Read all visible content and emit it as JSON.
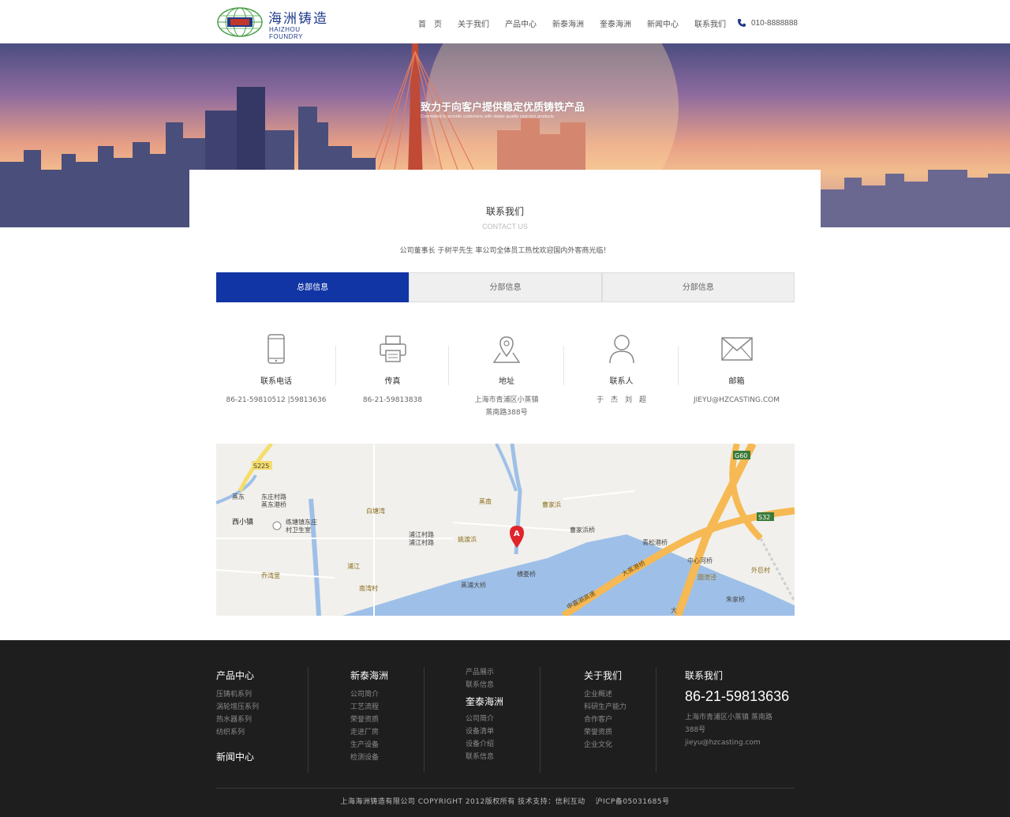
{
  "brand": {
    "name_cn": "海洲铸造",
    "name_en": "HAIZHOU FOUNDRY",
    "primary_color": "#1235a5"
  },
  "nav": {
    "items": [
      "首　页",
      "关于我们",
      "产品中心",
      "新泰海洲",
      "奎泰海洲",
      "新闻中心",
      "联系我们"
    ],
    "phone": "010-8888888",
    "phone_icon": "phone-icon"
  },
  "banner": {
    "title": "致力于向客户提供稳定优质铸铁产品",
    "subtitle": "Committed to provide customers with stable quality cast iron products"
  },
  "section": {
    "title": "联系我们",
    "subtitle": "CONTACT US",
    "description": "公司董事长 于树平先生 率公司全体员工热忱欢迎国内外客商光临！"
  },
  "tabs": [
    {
      "label": "总部信息",
      "active": true
    },
    {
      "label": "分部信息",
      "active": false
    },
    {
      "label": "分部信息",
      "active": false
    }
  ],
  "contacts": [
    {
      "icon": "mobile-phone-icon",
      "label": "联系电话",
      "value": "86-21-59810512 |59813636"
    },
    {
      "icon": "fax-printer-icon",
      "label": "传真",
      "value": "86-21-59813838"
    },
    {
      "icon": "map-pin-icon",
      "label": "地址",
      "value": "上海市青浦区小蒸镇",
      "value2": "蒸南路388号"
    },
    {
      "icon": "person-icon",
      "label": "联系人",
      "value": "于　杰　刘　超"
    },
    {
      "icon": "envelope-icon",
      "label": "邮箱",
      "value": "JIEYU@HZCASTING.COM"
    }
  ],
  "map": {
    "labels": {
      "s225": "S225",
      "g60": "G60",
      "s32": "S32",
      "zhengdong": "蒸东",
      "dongzhuang": "东庄村路",
      "zhengdongqiao": "蒸东港桥",
      "xixiao": "西小镇",
      "liantang": "练塘镇东庄",
      "weisheng": "村卫生室",
      "baitang": "白塘湾",
      "zhengnan": "蒸南",
      "caojiabang": "曹家浜",
      "caojiabangqiao": "曹家浜桥",
      "pujiang1": "浦江村路",
      "pujiang2": "浦江村路",
      "yaodu": "姚渡浜",
      "qingsong": "青松港桥",
      "pujiangcun": "浦江",
      "qiaowan": "乔湾里",
      "nanwan": "南湾村",
      "zhengpu": "蒸浦大桥",
      "henglou": "横娄桥",
      "shenjiahu": "申嘉湖高速",
      "dazheng": "大蒸港桥",
      "zhongxin": "中心河桥",
      "waiju": "外巨村",
      "yuanlu": "圆泄泾",
      "zhujia": "朱家桥",
      "da": "大",
      "marker": "A"
    }
  },
  "footer": {
    "col1": {
      "title": "产品中心",
      "items": [
        "压铸机系列",
        "涡轮增压系列",
        "热水器系列",
        "纺织系列"
      ],
      "title2": "新闻中心"
    },
    "col2": {
      "title": "新泰海洲",
      "items": [
        "公司简介",
        "工艺流程",
        "荣誉资质",
        "走进厂房",
        "生产设备",
        "检测设备"
      ]
    },
    "col3": {
      "pre": [
        "产品展示",
        "联系信息"
      ],
      "title": "奎泰海洲",
      "items": [
        "公司简介",
        "设备清单",
        "设备介绍",
        "联系信息"
      ]
    },
    "col4": {
      "title": "关于我们",
      "items": [
        "企业概述",
        "科研生产能力",
        "合作客户",
        "荣誉资质",
        "企业文化"
      ]
    },
    "col5": {
      "title": "联系我们",
      "phone": "86-21-59813636",
      "address1": "上海市青浦区小蒸镇 蒸南路",
      "address2": "388号",
      "email": "jieyu@hzcasting.com"
    },
    "copyright": "上海海洲铸造有限公司 COPYRIGHT 2012版权所有 技术支持：信利互动　 沪ICP备05031685号"
  }
}
